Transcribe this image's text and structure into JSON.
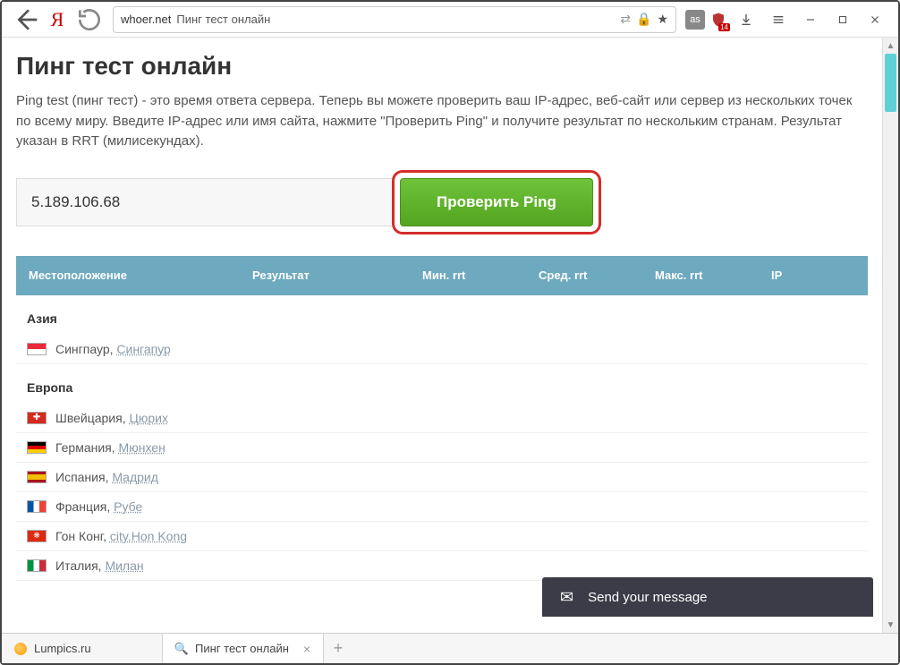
{
  "browser": {
    "url_host": "whoer.net",
    "url_title": "Пинг тест онлайн",
    "shield_badge": "14",
    "ext_as": "as"
  },
  "page": {
    "title": "Пинг тест онлайн",
    "description": "Ping test (пинг тест) - это время ответа сервера. Теперь вы можете проверить ваш IP-адрес, веб-сайт или сервер из нескольких точек по всему миру. Введите IP-адрес или имя сайта, нажмите \"Проверить Ping\" и получите результат по нескольким странам. Результат указан в RRT (милисекундах).",
    "ip_value": "5.189.106.68",
    "check_label": "Проверить Ping"
  },
  "table": {
    "headers": {
      "location": "Местоположение",
      "result": "Результат",
      "min": "Мин. rrt",
      "avg": "Сред. rrt",
      "max": "Макс. rrt",
      "ip": "IP"
    }
  },
  "regions": [
    {
      "name": "Азия",
      "rows": [
        {
          "flag": "sg",
          "country": "Сингпаур, ",
          "city": "Сингапур"
        }
      ]
    },
    {
      "name": "Европа",
      "rows": [
        {
          "flag": "ch",
          "country": "Швейцария, ",
          "city": "Цюрих"
        },
        {
          "flag": "de",
          "country": "Германия, ",
          "city": "Мюнхен"
        },
        {
          "flag": "es",
          "country": "Испания, ",
          "city": "Мадрид"
        },
        {
          "flag": "fr",
          "country": "Франция, ",
          "city": "Рубе"
        },
        {
          "flag": "hk",
          "country": "Гон Конг, ",
          "city": "city.Hon Kong"
        },
        {
          "flag": "it",
          "country": "Италия, ",
          "city": "Милан"
        }
      ]
    }
  ],
  "chat": {
    "label": "Send your message"
  },
  "tabs": [
    {
      "icon": "orange",
      "label": "Lumpics.ru",
      "active": false,
      "closeable": false
    },
    {
      "icon": "search",
      "label": "Пинг тест онлайн",
      "active": true,
      "closeable": true
    }
  ]
}
